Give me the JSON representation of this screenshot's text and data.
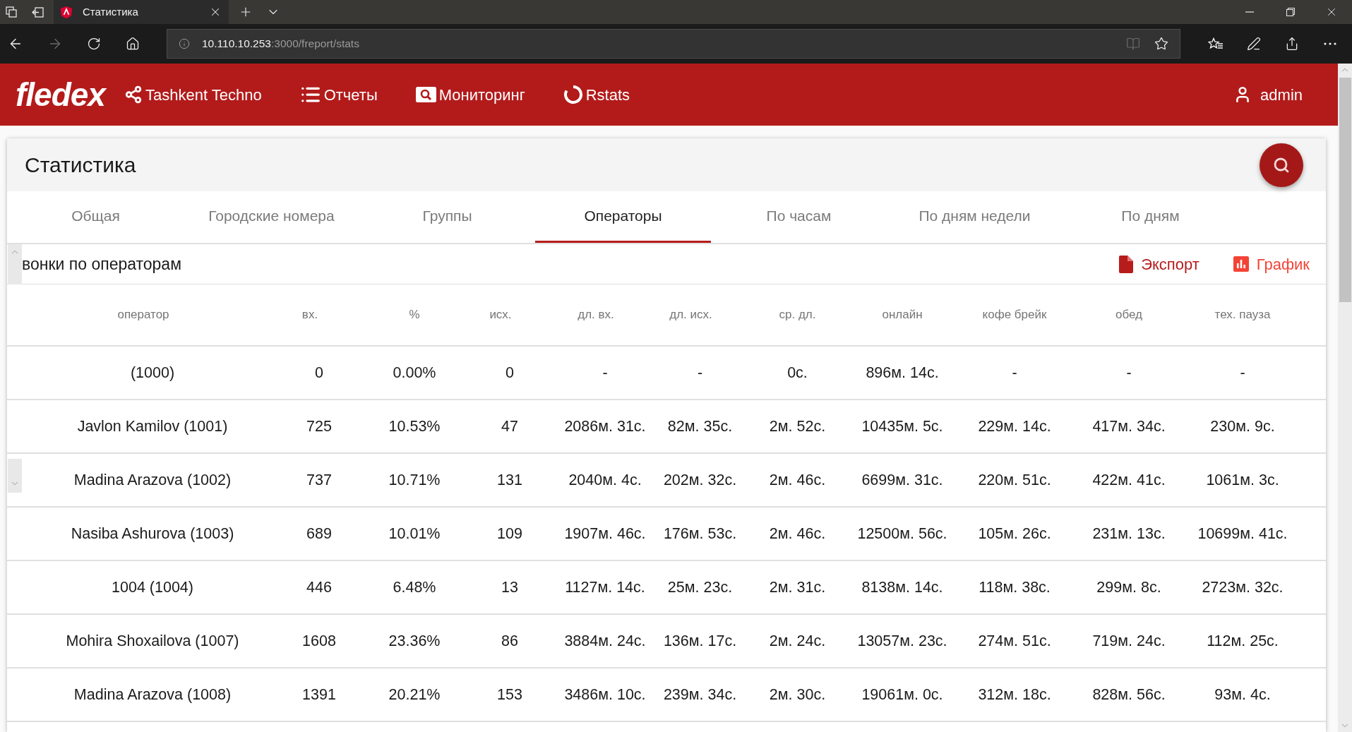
{
  "browser": {
    "tab_title": "Статистика",
    "url_host": "10.110.10.253",
    "url_path": ":3000/freport/stats",
    "forward_disabled": true,
    "reading_view_disabled": true
  },
  "navbar": {
    "logo": "fledex",
    "items": [
      {
        "label": "Tashkent Techno",
        "kind": "share"
      },
      {
        "label": "Отчеты",
        "kind": "list"
      },
      {
        "label": "Мониторинг",
        "kind": "monitor"
      },
      {
        "label": "Rstats",
        "kind": "ring"
      }
    ],
    "user": "admin"
  },
  "page": {
    "title": "Статистика"
  },
  "tabs": [
    {
      "label": "Общая",
      "selected": false
    },
    {
      "label": "Городские номера",
      "selected": false
    },
    {
      "label": "Группы",
      "selected": false
    },
    {
      "label": "Операторы",
      "selected": true
    },
    {
      "label": "По часам",
      "selected": false
    },
    {
      "label": "По дням недели",
      "selected": false
    },
    {
      "label": "По дням",
      "selected": false
    }
  ],
  "section": {
    "title": "вонки по операторам",
    "actions": [
      {
        "label": "Экспорт",
        "kind": "export"
      },
      {
        "label": "График",
        "kind": "chart"
      }
    ]
  },
  "table": {
    "columns": [
      "оператор",
      "вх.",
      "%",
      "исх.",
      "дл. вх.",
      "дл. исх.",
      "ср. дл.",
      "онлайн",
      "кофе брейк",
      "обед",
      "тех. пауза"
    ],
    "rows": [
      [
        "(1000)",
        "0",
        "0.00%",
        "0",
        "-",
        "-",
        "0с.",
        "896м. 14с.",
        "-",
        "-",
        "-"
      ],
      [
        "Javlon Kamilov (1001)",
        "725",
        "10.53%",
        "47",
        "2086м. 31с.",
        "82м. 35с.",
        "2м. 52с.",
        "10435м. 5с.",
        "229м. 14с.",
        "417м. 34с.",
        "230м. 9с."
      ],
      [
        "Madina Arazova (1002)",
        "737",
        "10.71%",
        "131",
        "2040м. 4с.",
        "202м. 32с.",
        "2м. 46с.",
        "6699м. 31с.",
        "220м. 51с.",
        "422м. 41с.",
        "1061м. 3с."
      ],
      [
        "Nasiba Ashurova (1003)",
        "689",
        "10.01%",
        "109",
        "1907м. 46с.",
        "176м. 53с.",
        "2м. 46с.",
        "12500м. 56с.",
        "105м. 26с.",
        "231м. 13с.",
        "10699м. 41с."
      ],
      [
        "1004 (1004)",
        "446",
        "6.48%",
        "13",
        "1127м. 14с.",
        "25м. 23с.",
        "2м. 31с.",
        "8138м. 14с.",
        "118м. 38с.",
        "299м. 8с.",
        "2723м. 32с."
      ],
      [
        "Mohira Shoxailova (1007)",
        "1608",
        "23.36%",
        "86",
        "3884м. 24с.",
        "136м. 17с.",
        "2м. 24с.",
        "13057м. 23с.",
        "274м. 51с.",
        "719м. 24с.",
        "112м. 25с."
      ],
      [
        "Madina Arazova (1008)",
        "1391",
        "20.21%",
        "153",
        "3486м. 10с.",
        "239м. 34с.",
        "2м. 30с.",
        "19061м. 0с.",
        "312м. 18с.",
        "828м. 56с.",
        "93м. 4с."
      ]
    ]
  }
}
